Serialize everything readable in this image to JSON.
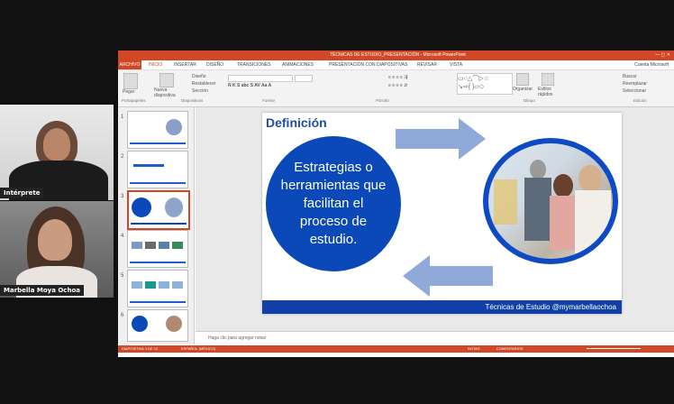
{
  "participants": [
    {
      "name": "Intérprete"
    },
    {
      "name": "Marbella Moya Ochoa"
    }
  ],
  "app": {
    "title": "TÉCNICAS DE ESTUDIO_PRESENTACIÓN - Microsoft PowerPoint",
    "account": "Cuenta Microsoft",
    "accent": "#d24726"
  },
  "tabs": [
    "ARCHIVO",
    "INICIO",
    "INSERTAR",
    "DISEÑO",
    "TRANSICIONES",
    "ANIMACIONES",
    "PRESENTACIÓN CON DIAPOSITIVAS",
    "REVISAR",
    "VISTA"
  ],
  "ribbon": {
    "groups": [
      "Portapapeles",
      "Diapositivas",
      "Fuente",
      "Párrafo",
      "Dibujo",
      "Edición"
    ],
    "buttons": {
      "paste": "Pegar",
      "new_slide": "Nueva diapositiva",
      "layout": "Diseño",
      "reset": "Restablecer",
      "section": "Sección",
      "arrange": "Organizar",
      "quick_styles": "Estilos rápidos",
      "find": "Buscar",
      "replace": "Reemplazar",
      "select": "Seleccionar"
    }
  },
  "thumbnails": [
    {
      "num": "1",
      "selected": false
    },
    {
      "num": "2",
      "selected": false
    },
    {
      "num": "3",
      "selected": true
    },
    {
      "num": "4",
      "selected": false
    },
    {
      "num": "5",
      "selected": false
    },
    {
      "num": "6",
      "selected": false
    }
  ],
  "slide": {
    "title": "Definición",
    "circle_text": "Estrategias o herramientas que facilitan el proceso de estudio.",
    "footer": "Técnicas de Estudio @mymarbellaochoa",
    "brand_blue": "#0b49b8"
  },
  "notes_placeholder": "Haga clic para agregar notas",
  "status": {
    "left": "DIAPOSITIVA 3 DE 12",
    "lang": "ESPAÑOL (MÉXICO)",
    "notes": "NOTAS",
    "comments": "COMENTARIOS"
  }
}
